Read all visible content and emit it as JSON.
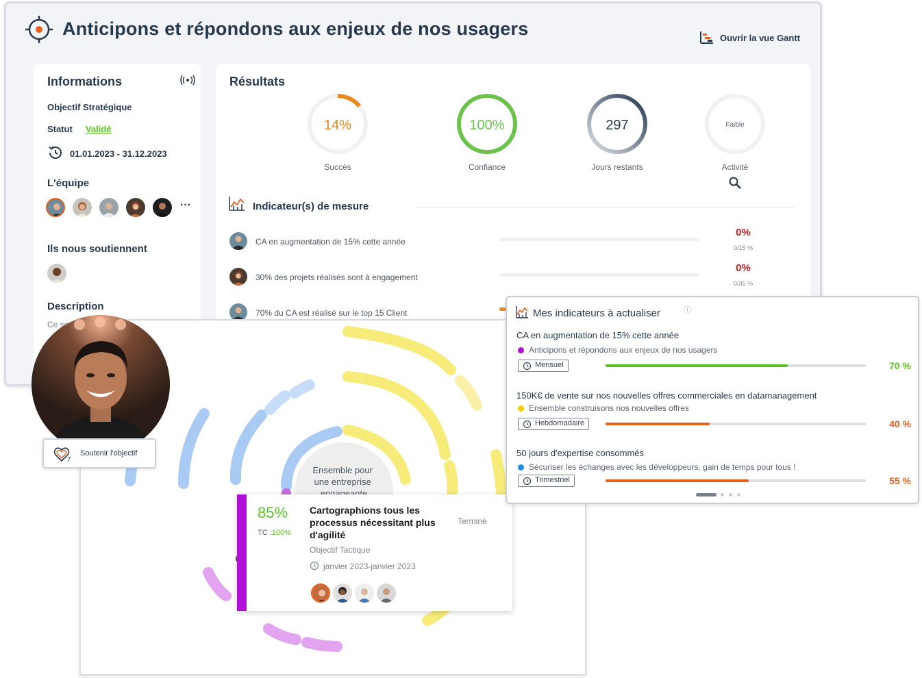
{
  "header": {
    "title": "Anticipons et répondons aux enjeux de nos usagers",
    "gantt_label": "Ouvrir la vue Gantt"
  },
  "info": {
    "title": "Informations",
    "type": "Objectif Stratégique",
    "status_label": "Statut",
    "status_value": "Validé",
    "dates": "01.01.2023 - 31.12.2023",
    "team_title": "L'équipe",
    "more": "···",
    "supporters_title": "Ils nous soutiennent",
    "description_title": "Description",
    "description_text": "Ce so"
  },
  "results": {
    "title": "Résultats",
    "gauges": [
      {
        "value": "14%",
        "label": "Succès",
        "fraction": 0.14
      },
      {
        "value": "100%",
        "label": "Confiance",
        "fraction": 1.0
      },
      {
        "value": "297",
        "label": "Jours restants"
      },
      {
        "value": "Faible",
        "label": "Activité"
      }
    ],
    "indicators_title": "Indicateur(s) de mesure",
    "indicators": [
      {
        "text": "CA en augmentation de 15% cette année",
        "pct": "0%",
        "sub": "0/15 %"
      },
      {
        "text": "30% des projets réalisés sont à engagement",
        "pct": "0%",
        "sub": "0/35 %"
      },
      {
        "text": "70% du CA est réalisé sur le top 15 Client"
      }
    ]
  },
  "support": {
    "label": "Soutenir l'objectif",
    "count": "7"
  },
  "sunburst": {
    "center_text": "Ensemble pour une entreprise engageante"
  },
  "task": {
    "percent": "85%",
    "tc_label": "TC :",
    "tc_value": "100%",
    "title": "Cartographions tous les processus nécessitant plus d'agilité",
    "status": "Terminé",
    "type": "Objectif Tactique",
    "dates": "janvier 2023-janvier 2023"
  },
  "mes_indicateurs": {
    "title": "Mes indicateurs à actualiser",
    "info_icon": "ⓘ",
    "items": [
      {
        "title": "CA en augmentation de 15% cette année",
        "objective": "Anticipons et répondons aux enjeux de nos usagers",
        "dot_color": "#b210d8",
        "frequency": "Mensuel",
        "pct": "70 %",
        "fraction": 0.7,
        "color": "#58c322"
      },
      {
        "title": "150K€ de vente sur nos nouvelles offres commerciales en datamanagement",
        "objective": "Ensemble construisons nos nouvelles offres",
        "dot_color": "#f2d20a",
        "frequency": "Hebdomadaire",
        "pct": "40 %",
        "fraction": 0.4,
        "color": "#e8601c"
      },
      {
        "title": "50 jours d'expertise consommés",
        "objective": "Sécuriser les échanges avec les développeurs, gain de temps pour tous !",
        "dot_color": "#1f8fe0",
        "frequency": "Trimestriel",
        "pct": "55 %",
        "fraction": 0.55,
        "color": "#e8601c"
      }
    ]
  },
  "colors": {
    "accent_orange": "#e8601c",
    "success_green": "#58c322",
    "danger_red": "#c41e1e",
    "navy": "#26384d",
    "purple": "#b210d8"
  }
}
